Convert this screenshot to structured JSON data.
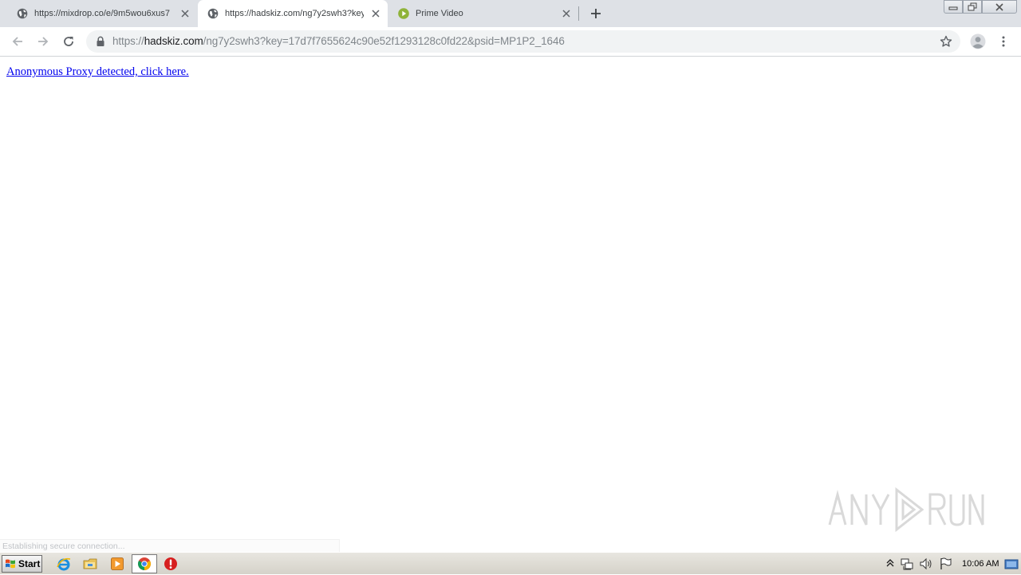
{
  "tabs": [
    {
      "title": "https://mixdrop.co/e/9m5wou6xus7",
      "favicon": "globe-icon",
      "active": false
    },
    {
      "title": "https://hadskiz.com/ng7y2swh3?key=17d7f7655624c90e52f1293128c0fd22&psid=MP1P2_1646",
      "favicon": "globe-icon",
      "active": true
    },
    {
      "title": "Prime Video",
      "favicon": "play-circle-icon",
      "active": false
    }
  ],
  "toolbar": {
    "url_scheme": "https://",
    "url_host": "hadskiz.com",
    "url_path": "/ng7y2swh3?key=17d7f7655624c90e52f1293128c0fd22&psid=MP1P2_1646"
  },
  "page": {
    "link_text": "Anonymous Proxy detected, click here.",
    "status_text": "Establishing secure connection..."
  },
  "taskbar": {
    "start_label": "Start",
    "clock": "10:06 AM"
  },
  "colors": {
    "tabstrip": "#dee1e6",
    "omnibox": "#f1f3f4",
    "link": "#0000ee",
    "prime_green": "#8fb339"
  }
}
